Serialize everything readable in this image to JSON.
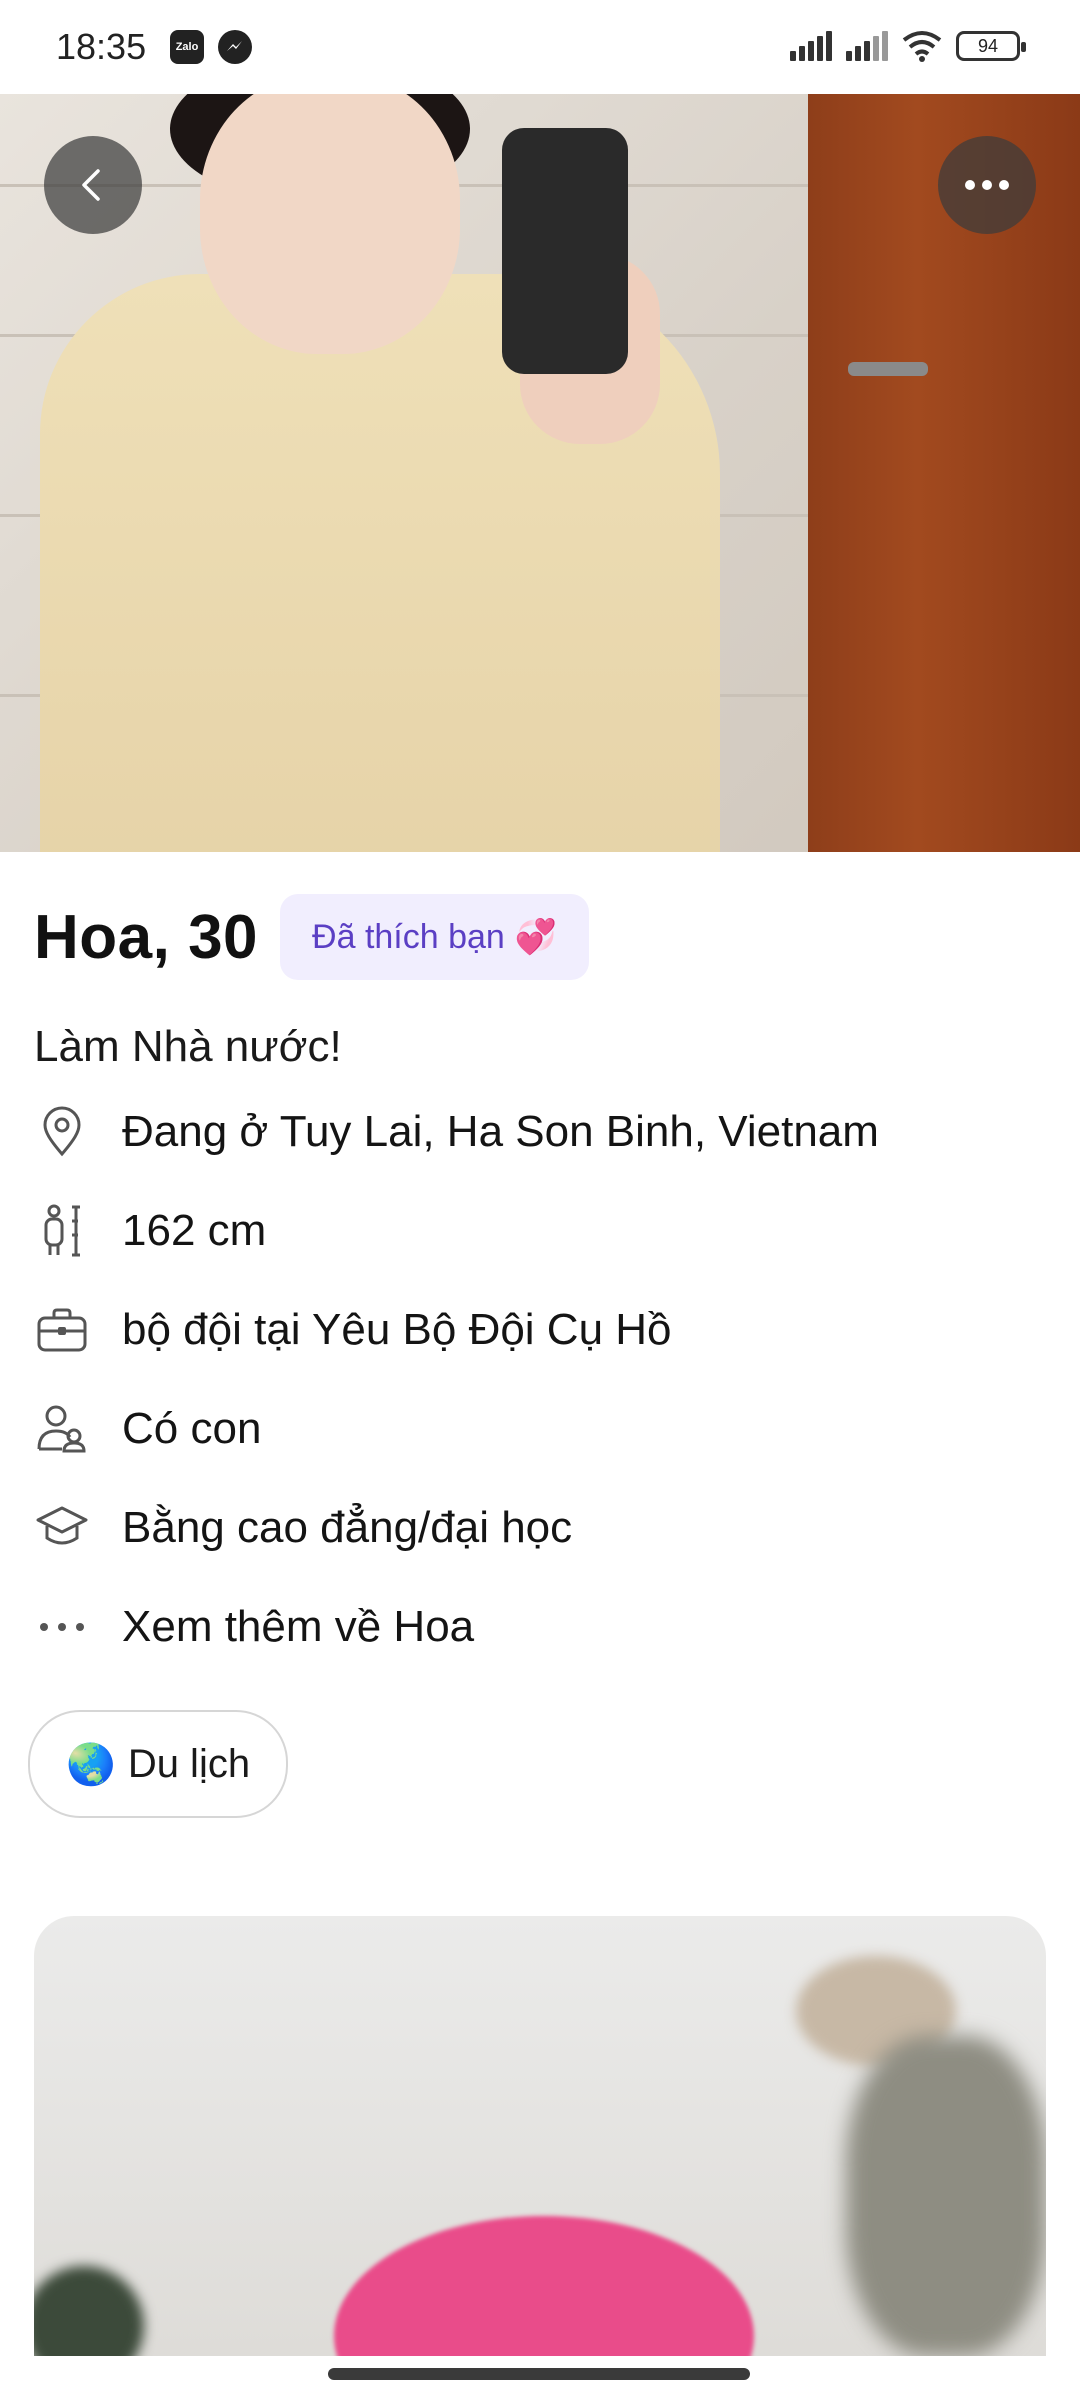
{
  "status_bar": {
    "time": "18:35",
    "apps": [
      "zalo-icon",
      "messenger-icon"
    ],
    "zalo_label": "Zalo",
    "battery": "94"
  },
  "hero": {
    "back_icon": "chevron-left-icon",
    "more_icon": "more-horizontal-icon"
  },
  "profile": {
    "name_age": "Hoa, 30",
    "liked_badge": "Đã thích bạn",
    "liked_emoji": "💞",
    "bio": "Làm Nhà nước!",
    "details": [
      {
        "icon": "location-pin-icon",
        "text": "Đang ở Tuy Lai, Ha Son Binh, Vietnam"
      },
      {
        "icon": "height-icon",
        "text": "162 cm"
      },
      {
        "icon": "briefcase-icon",
        "text": "bộ đội tại Yêu Bộ Đội Cụ Hồ"
      },
      {
        "icon": "children-icon",
        "text": "Có con"
      },
      {
        "icon": "graduation-cap-icon",
        "text": "Bằng cao đẳng/đại học"
      },
      {
        "icon": "more-dots-icon",
        "text": "Xem thêm về Hoa"
      }
    ],
    "interests": [
      {
        "emoji": "🌏",
        "label": "Du lịch"
      }
    ]
  },
  "colors": {
    "accent": "#5b3fc4",
    "badge_bg": "#f1eefe"
  }
}
